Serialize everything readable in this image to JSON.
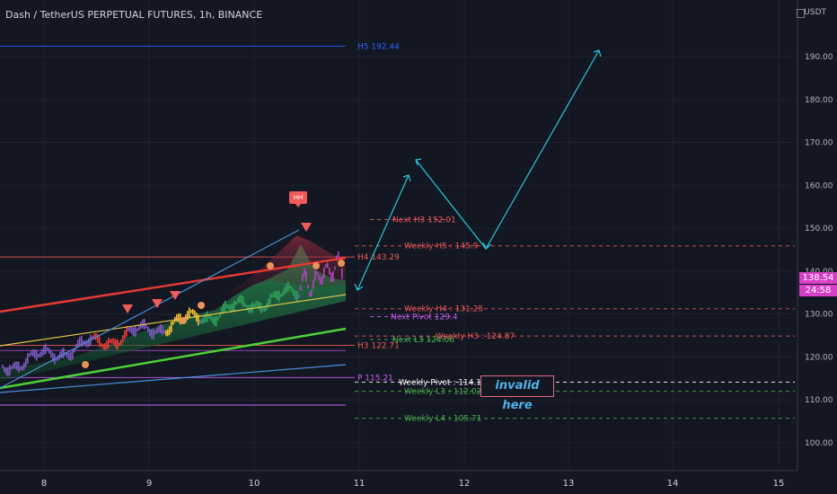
{
  "header": {
    "title": "Dash / TetherUS PERPETUAL FUTURES, 1h, BINANCE",
    "unit": "USDT"
  },
  "chart_data": {
    "type": "line",
    "title": "Dash / TetherUS PERPETUAL FUTURES, 1h, BINANCE",
    "ylim": [
      94,
      200
    ],
    "y_ticks": [
      100,
      110,
      120,
      130,
      140,
      150,
      160,
      170,
      180,
      190
    ],
    "x_ticks": [
      "8",
      "9",
      "10",
      "11",
      "12",
      "13",
      "14",
      "15"
    ],
    "grid": true,
    "current_price": "138.54",
    "countdown": "24:58",
    "hh_label": "HH",
    "annotation": "invalid here",
    "levels": [
      {
        "label": "H5 192.44",
        "value": 192.44,
        "color": "#2962ff",
        "style": "solid"
      },
      {
        "label": "Next H3 152.01",
        "value": 152.01,
        "color": "#f05a5a",
        "style": "dashed"
      },
      {
        "label": "Weekly H5 : 145.9",
        "value": 145.9,
        "color": "#f05a5a",
        "style": "dashed"
      },
      {
        "label": "H4 143.29",
        "value": 143.29,
        "color": "#f05a5a",
        "style": "solid"
      },
      {
        "label": "Weekly H4 : 131.25",
        "value": 131.25,
        "color": "#f05a5a",
        "style": "dashed"
      },
      {
        "label": "Next Pivot 129.4",
        "value": 129.4,
        "color": "#c95df3",
        "style": "dashed"
      },
      {
        "label": "Next L3 124.06",
        "value": 124.06,
        "color": "#4caf50",
        "style": "dashed"
      },
      {
        "label": "Weekly H3 : 124.87",
        "value": 124.87,
        "color": "#f05a5a",
        "style": "dashed"
      },
      {
        "label": "H3 122.71",
        "value": 122.71,
        "color": "#f05a5a",
        "style": "solid"
      },
      {
        "label": "P 115.21",
        "value": 115.21,
        "color": "#c95df3",
        "style": "solid"
      },
      {
        "label": "Weekly Pivot : 114.12",
        "value": 114.12,
        "color": "#ffffff",
        "style": "dashed"
      },
      {
        "label": "Weekly L3 : 112.02",
        "value": 112.02,
        "color": "#4caf50",
        "style": "dashed"
      },
      {
        "label": "Weekly L4 : 105.71",
        "value": 105.71,
        "color": "#4caf50",
        "style": "dashed"
      }
    ]
  }
}
